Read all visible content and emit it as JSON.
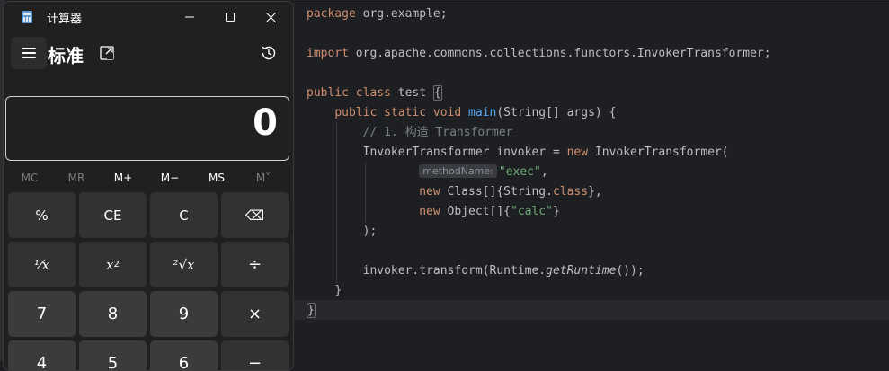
{
  "editor": {
    "lines": {
      "package_kw": "package",
      "package_name": "org.example;",
      "import_kw": "import",
      "import_path": "org.apache.commons.collections.functors.InvokerTransformer;",
      "class_kw": "public class",
      "class_name": "test",
      "open_brace": "{",
      "method_mods": "public static void",
      "method_name": "main",
      "method_params": "(String[] args) {",
      "comment": "// 1. 构造 Transformer",
      "decl": "InvokerTransformer invoker = ",
      "new_kw": "new",
      "ctor": "InvokerTransformer(",
      "param_hint": "methodName:",
      "arg1": "\"exec\"",
      "comma": ",",
      "arg2_new": "new",
      "arg2": "Class[]{String.",
      "arg2_class": "class",
      "arg2_end": "},",
      "arg3_new": "new",
      "arg3_a": "Object[]{",
      "arg3_str": "\"calc\"",
      "arg3_end": "}",
      "close_paren": ");",
      "call_a": "invoker.transform(Runtime.",
      "call_fn": "getRuntime",
      "call_end": "());",
      "close_method": "}",
      "close_class": "}"
    }
  },
  "calculator": {
    "title": "计算器",
    "mode": "标准",
    "display_value": "0",
    "memory_buttons": [
      {
        "label": "MC",
        "enabled": false
      },
      {
        "label": "MR",
        "enabled": false
      },
      {
        "label": "M+",
        "enabled": true
      },
      {
        "label": "M−",
        "enabled": true
      },
      {
        "label": "MS",
        "enabled": true
      },
      {
        "label": "M˅",
        "enabled": false
      }
    ],
    "keys": {
      "percent": "%",
      "ce": "CE",
      "c": "C",
      "backspace": "⌫",
      "reciprocal": "¹⁄x",
      "square_base": "x",
      "square_exp": "2",
      "sqrt": "²√x",
      "divide": "÷",
      "seven": "7",
      "eight": "8",
      "nine": "9",
      "multiply": "×",
      "four": "4",
      "five": "5",
      "six": "6",
      "minus": "−"
    }
  }
}
